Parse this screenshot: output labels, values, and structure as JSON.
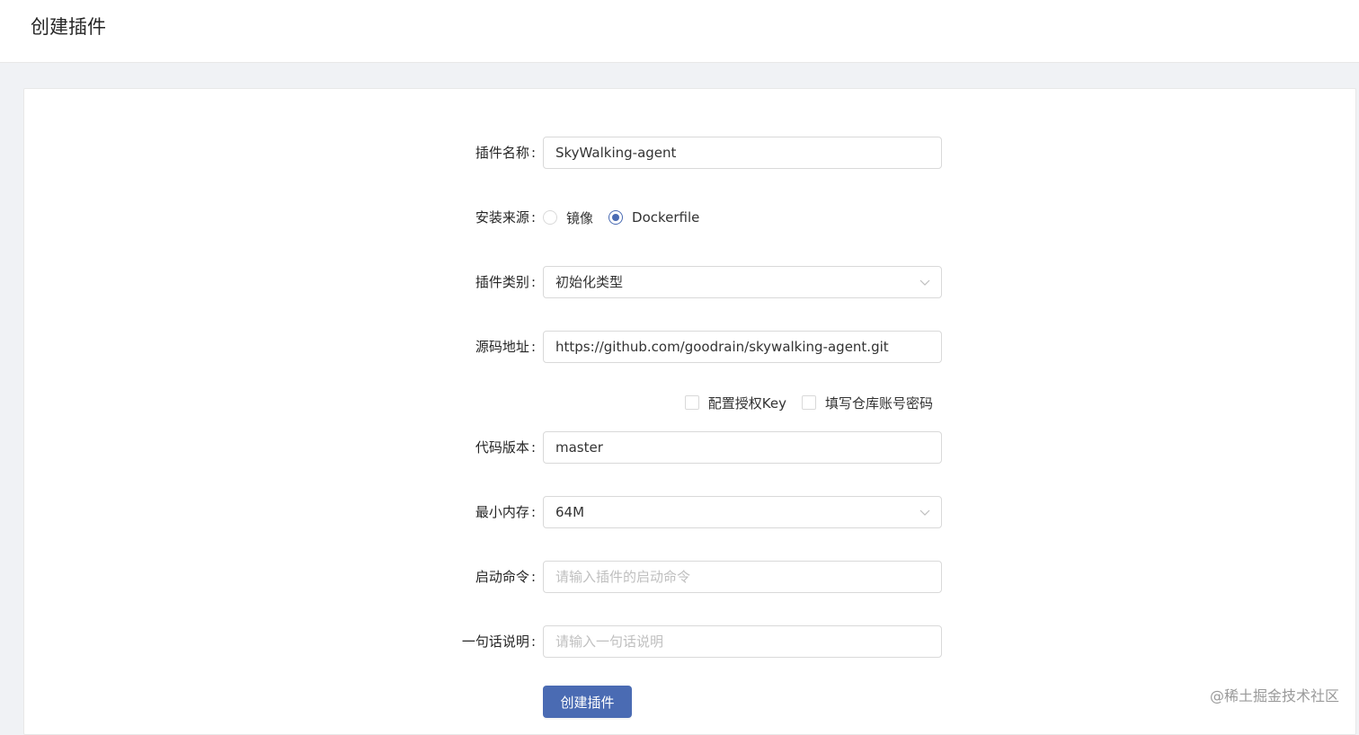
{
  "header": {
    "title": "创建插件"
  },
  "form": {
    "plugin_name": {
      "label": "插件名称",
      "value": "SkyWalking-agent"
    },
    "install_source": {
      "label": "安装来源",
      "options": [
        {
          "label": "镜像",
          "checked": false
        },
        {
          "label": "Dockerfile",
          "checked": true
        }
      ]
    },
    "plugin_type": {
      "label": "插件类别",
      "value": "初始化类型"
    },
    "source_url": {
      "label": "源码地址",
      "value": "https://github.com/goodrain/skywalking-agent.git"
    },
    "source_options": [
      {
        "label": "配置授权Key",
        "checked": false
      },
      {
        "label": "填写仓库账号密码",
        "checked": false
      }
    ],
    "code_version": {
      "label": "代码版本",
      "value": "master"
    },
    "min_memory": {
      "label": "最小内存",
      "value": "64M"
    },
    "start_command": {
      "label": "启动命令",
      "placeholder": "请输入插件的启动命令"
    },
    "description": {
      "label": "一句话说明",
      "placeholder": "请输入一句话说明"
    },
    "submit_label": "创建插件",
    "colon": ":"
  },
  "watermark": "@稀土掘金技术社区",
  "colors": {
    "primary": "#4a6bb3",
    "border": "#d9d9d9",
    "page_bg": "#f0f2f5"
  }
}
